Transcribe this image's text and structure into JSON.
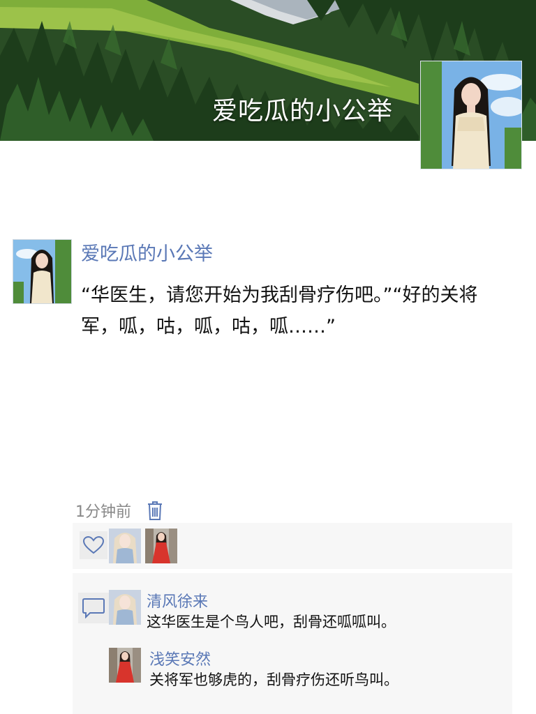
{
  "cover": {
    "title": "爱吃瓜的小公举"
  },
  "post": {
    "author": "爱吃瓜的小公举",
    "content": "“华医生，请您开始为我刮骨疗伤吧。”“好的关将军，呱，咕，呱，咕，呱……”",
    "time": "1分钟前",
    "delete_icon": "trash-icon"
  },
  "likes": {
    "icon": "heart-icon"
  },
  "comments_icon": "comment-bubble-icon",
  "comments": [
    {
      "name": "清风徐来",
      "text": "这华医生是个鸟人吧，刮骨还呱呱叫。"
    },
    {
      "name": "浅笑安然",
      "text": "关将军也够虎的，刮骨疗伤还听鸟叫。"
    }
  ],
  "colors": {
    "link": "#5a78b6",
    "text": "#111111",
    "meta": "#888888",
    "panel": "#f7f7f7"
  }
}
